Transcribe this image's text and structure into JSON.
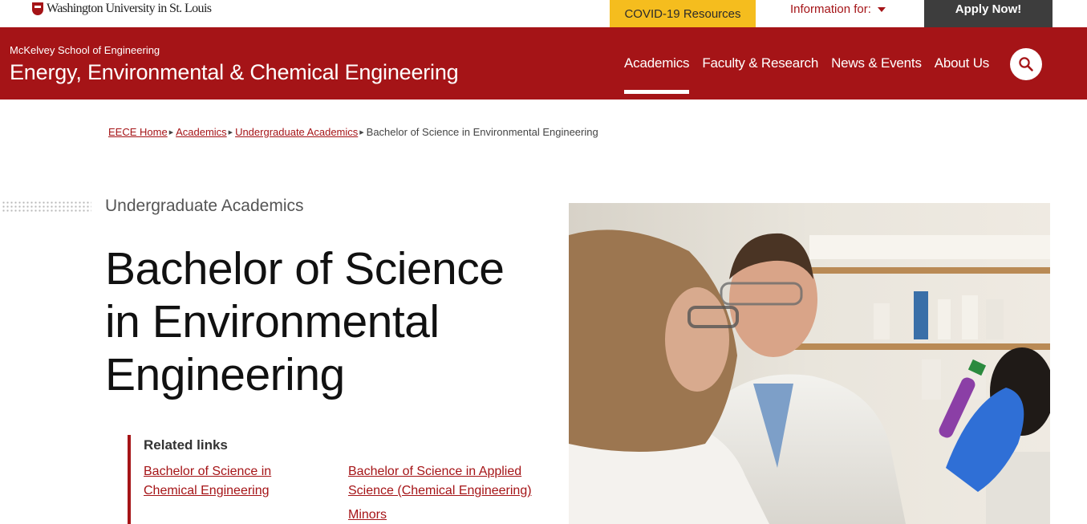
{
  "topbar": {
    "logo_text": "Washington University in St. Louis",
    "covid_label": "COVID-19 Resources",
    "info_label": "Information for:",
    "apply_label": "Apply Now!"
  },
  "header": {
    "school": "McKelvey School of Engineering",
    "department": "Energy, Environmental & Chemical Engineering",
    "nav": [
      {
        "label": "Academics"
      },
      {
        "label": "Faculty & Research"
      },
      {
        "label": "News & Events"
      },
      {
        "label": "About Us"
      }
    ],
    "search_icon": "search-icon"
  },
  "breadcrumb": [
    {
      "label": "EECE Home"
    },
    {
      "label": "Academics"
    },
    {
      "label": "Undergraduate Academics"
    },
    {
      "label": "Bachelor of Science in Environmental Engineering"
    }
  ],
  "main": {
    "section_label": "Undergraduate Academics",
    "title": "Bachelor of Science in Environmental Engineering",
    "related": {
      "heading": "Related links",
      "links": [
        {
          "label": "Bachelor of Science in Chemical Engineering"
        },
        {
          "label": "Bachelor of Science in Applied Science (Chemical Engineering)"
        },
        {
          "label": "Minors"
        }
      ]
    }
  },
  "colors": {
    "brand_red": "#a51417",
    "covid_yellow": "#f5bd1e",
    "apply_dark": "#3d3d3d"
  }
}
